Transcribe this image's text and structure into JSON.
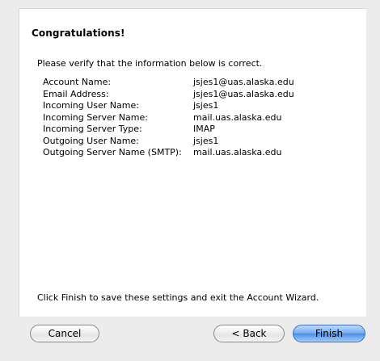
{
  "dialog": {
    "title": "Congratulations!",
    "intro": "Please verify that the information below is correct.",
    "fields": [
      {
        "label": "Account Name:",
        "value": "jsjes1@uas.alaska.edu"
      },
      {
        "label": "Email Address:",
        "value": "jsjes1@uas.alaska.edu"
      },
      {
        "label": "Incoming User Name:",
        "value": "jsjes1"
      },
      {
        "label": "Incoming Server Name:",
        "value": "mail.uas.alaska.edu"
      },
      {
        "label": "Incoming Server Type:",
        "value": "IMAP"
      },
      {
        "label": "Outgoing User Name:",
        "value": "jsjes1"
      },
      {
        "label": "Outgoing Server Name (SMTP):",
        "value": "mail.uas.alaska.edu"
      }
    ],
    "footer": "Click Finish to save these settings and exit the Account Wizard."
  },
  "buttons": {
    "cancel": "Cancel",
    "back": "< Back",
    "finish": "Finish"
  }
}
